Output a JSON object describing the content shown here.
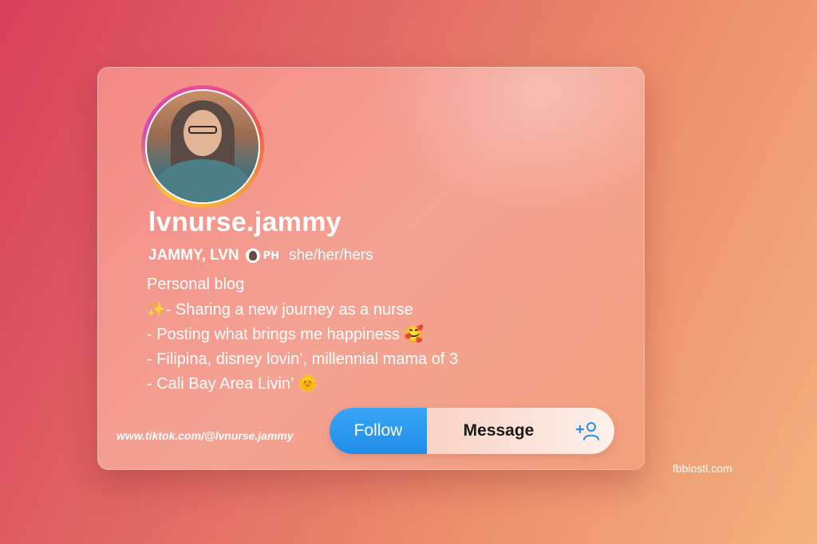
{
  "profile": {
    "username": "lvnurse.jammy",
    "full_name": "JAMMY, LVN",
    "country_code": "PH",
    "pronouns": "she/her/hers",
    "category": "Personal blog",
    "bio_lines": [
      {
        "emoji": "✨",
        "text": "- Sharing a new journey as a nurse"
      },
      {
        "emoji": "",
        "text": "- Posting what brings me happiness 🥰"
      },
      {
        "emoji": "",
        "text": "- Filipina, disney lovin’, millennial mama of 3"
      },
      {
        "emoji": "",
        "text": "- Cali Bay Area Livin’ 🌞"
      }
    ],
    "link": "www.tiktok.com/@lvnurse.jammy"
  },
  "actions": {
    "follow_label": "Follow",
    "message_label": "Message",
    "add_friend_icon": "add-person-icon"
  },
  "watermark": "fbbiostl.com",
  "colors": {
    "follow_blue": "#2196f3",
    "background_start": "#d8405a",
    "background_end": "#f3b27f"
  }
}
